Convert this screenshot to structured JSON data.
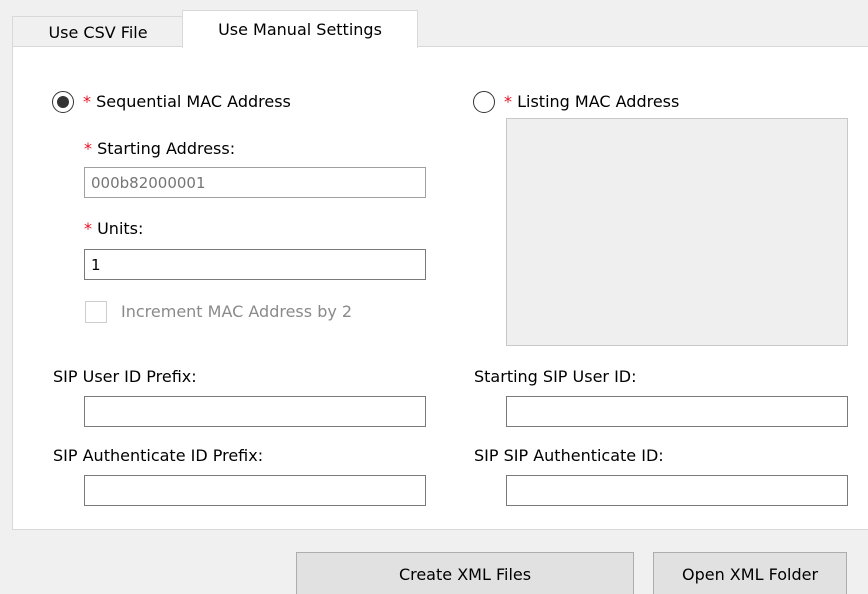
{
  "tabs": [
    {
      "label": "Use CSV File",
      "active": false
    },
    {
      "label": "Use Manual Settings",
      "active": true
    }
  ],
  "required_marker": "*",
  "sequential": {
    "radio_label": "Sequential MAC Address",
    "selected": true,
    "starting_address_label": "Starting Address:",
    "starting_address_placeholder": "000b82000001",
    "units_label": "Units:",
    "units_value": "1",
    "increment_label": "Increment MAC Address by 2",
    "increment_checked": false
  },
  "listing": {
    "radio_label": "Listing MAC Address",
    "selected": false
  },
  "sip": {
    "user_id_prefix_label": "SIP User ID Prefix:",
    "user_id_prefix_value": "",
    "starting_user_id_label": "Starting SIP User ID:",
    "starting_user_id_value": "",
    "auth_id_prefix_label": "SIP Authenticate ID Prefix:",
    "auth_id_prefix_value": "",
    "sip_auth_id_label": "SIP SIP Authenticate ID:",
    "sip_auth_id_value": ""
  },
  "buttons": {
    "create_xml": "Create XML Files",
    "open_xml_folder": "Open XML Folder"
  },
  "colors": {
    "required": "#e81123",
    "window_bg": "#f0f0f0",
    "panel_bg": "#ffffff",
    "button_bg": "#e1e1e1",
    "listbox_bg": "#efefef"
  },
  "icons": {
    "radio_selected": "radio-selected-icon",
    "radio_unselected": "radio-unselected-icon",
    "checkbox": "checkbox-icon"
  }
}
